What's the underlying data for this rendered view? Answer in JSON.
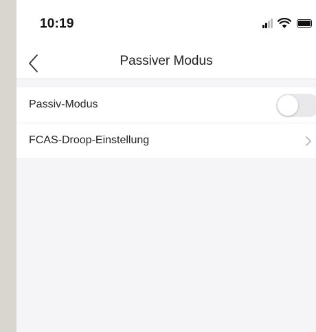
{
  "status_bar": {
    "time": "10:19",
    "icons": [
      "signal-icon",
      "wifi-icon",
      "battery-icon"
    ]
  },
  "nav": {
    "back_icon": "chevron-left-icon",
    "title": "Passiver Modus"
  },
  "settings": [
    {
      "label": "Passiv-Modus",
      "control": "toggle",
      "enabled": false
    },
    {
      "label": "FCAS-Droop-Einstellung",
      "control": "chevron-right-icon"
    }
  ],
  "colors": {
    "toggle_off": "#e9e9eb",
    "background": "#f5f5f7",
    "surface": "#ffffff"
  }
}
